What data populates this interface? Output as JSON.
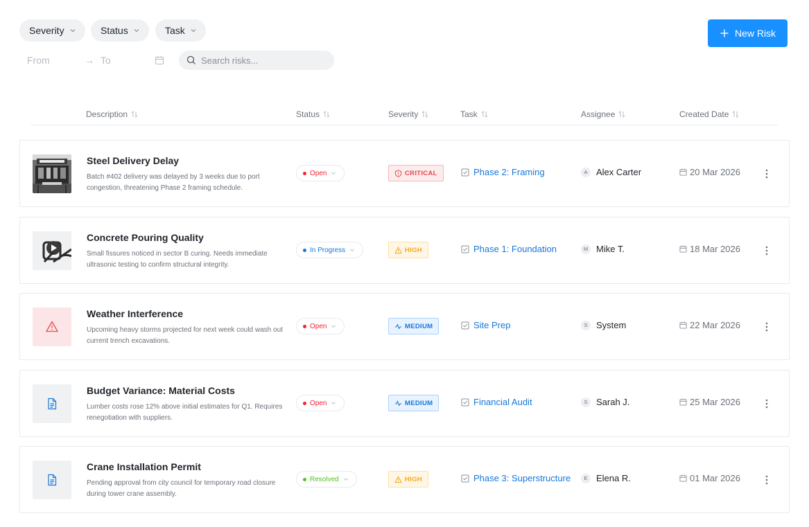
{
  "filters": {
    "severity_label": "Severity",
    "status_label": "Status",
    "task_label": "Task",
    "from_placeholder": "From",
    "arrow": "→",
    "to_placeholder": "To",
    "search_placeholder": "Search risks..."
  },
  "actions": {
    "new_risk_label": "New Risk",
    "new_risk_icon": "plus-icon",
    "accent_color": "#1890ff"
  },
  "table": {
    "columns": [
      "Description",
      "Status",
      "Severity",
      "Task",
      "Assignee",
      "Created Date"
    ]
  },
  "rows": [
    {
      "title": "Steel Delivery Delay",
      "description": "Batch #402 delivery was delayed by 3 weeks due to port congestion, threatening Phase 2 framing schedule.",
      "thumbnail": "photo-thumbnail",
      "status": "Open",
      "severity": "CRITICAL",
      "task": "Phase 2: Framing",
      "assignee_initial": "A",
      "assignee": "Alex Carter",
      "created": "20 Mar 2026"
    },
    {
      "title": "Concrete Pouring Quality",
      "description": "Small fissures noticed in sector B curing. Needs immediate ultrasonic testing to confirm structural integrity.",
      "thumbnail": "video-thumbnail",
      "status": "In Progress",
      "severity": "HIGH",
      "task": "Phase 1: Foundation",
      "assignee_initial": "M",
      "assignee": "Mike T.",
      "created": "18 Mar 2026"
    },
    {
      "title": "Weather Interference",
      "description": "Upcoming heavy storms projected for next week could wash out current trench excavations.",
      "thumbnail": "warning-thumbnail",
      "status": "Open",
      "severity": "MEDIUM",
      "task": "Site Prep",
      "assignee_initial": "S",
      "assignee": "System",
      "created": "22 Mar 2026"
    },
    {
      "title": "Budget Variance: Material Costs",
      "description": "Lumber costs rose 12% above initial estimates for Q1. Requires renegotiation with suppliers.",
      "thumbnail": "document-thumbnail",
      "status": "Open",
      "severity": "MEDIUM",
      "task": "Financial Audit",
      "assignee_initial": "S",
      "assignee": "Sarah J.",
      "created": "25 Mar 2026"
    },
    {
      "title": "Crane Installation Permit",
      "description": "Pending approval from city council for temporary road closure during tower crane assembly.",
      "thumbnail": "document-thumbnail",
      "status": "Resolved",
      "severity": "HIGH",
      "task": "Phase 3: Superstructure",
      "assignee_initial": "E",
      "assignee": "Elena R.",
      "created": "01 Mar 2026"
    }
  ],
  "colors": {
    "status_open": "#f5222d",
    "status_in_progress": "#1677d9",
    "status_resolved": "#52c41a",
    "severity_critical": "#e8484d",
    "severity_high": "#f5a623",
    "severity_medium": "#1677d9",
    "link": "#1677d9"
  }
}
